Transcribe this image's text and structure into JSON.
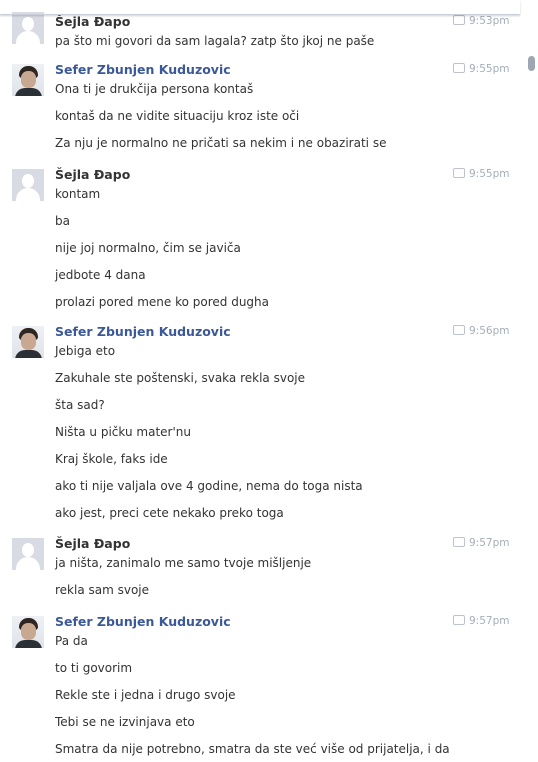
{
  "messages": [
    {
      "sender": "Šejla Đapo",
      "time": "9:53pm",
      "avatar": "default-avatar-icon",
      "lines": [
        "pa što mi govori da sam lagala? zatp što jkoj ne paše"
      ]
    },
    {
      "sender": "Sefer Zbunjen Kuduzovic",
      "time": "9:55pm",
      "avatar": "profile-photo",
      "lines": [
        "Ona ti je drukčija persona kontaš",
        "kontaš da ne vidite situaciju kroz iste oči",
        "Za nju je normalno ne pričati sa nekim i ne obazirati se"
      ]
    },
    {
      "sender": "Šejla Đapo",
      "time": "9:55pm",
      "avatar": "default-avatar-icon",
      "lines": [
        "kontam",
        "ba",
        "nije joj normalno, čim se javiča",
        "jedbote 4 dana",
        "prolazi pored mene ko pored dugha"
      ]
    },
    {
      "sender": "Sefer Zbunjen Kuduzovic",
      "time": "9:56pm",
      "avatar": "profile-photo",
      "lines": [
        "Jebiga eto",
        "Zakuhale ste poštenski, svaka rekla svoje",
        "šta sad?",
        "Ništa u pičku mater'nu",
        "Kraj škole, faks ide",
        "ako ti nije valjala ove 4 godine, nema do toga nista",
        "ako jest, preci cete nekako preko toga"
      ]
    },
    {
      "sender": "Šejla Đapo",
      "time": "9:57pm",
      "avatar": "default-avatar-icon",
      "lines": [
        "ja ništa, zanimalo me samo tvoje mišljenje",
        "rekla sam svoje"
      ]
    },
    {
      "sender": "Sefer Zbunjen Kuduzovic",
      "time": "9:57pm",
      "avatar": "profile-photo",
      "lines": [
        "Pa da",
        "to ti govorim",
        "Rekle ste i jedna i drugo svoje",
        "Tebi se ne izvinjava eto",
        "Smatra da nije potrebno, smatra da ste već više od prijatelja, i da"
      ]
    }
  ],
  "colors": {
    "sender_friend": "#3b5998",
    "sender_self": "#333333",
    "timestamp": "#a6adb9",
    "text": "#333333"
  }
}
